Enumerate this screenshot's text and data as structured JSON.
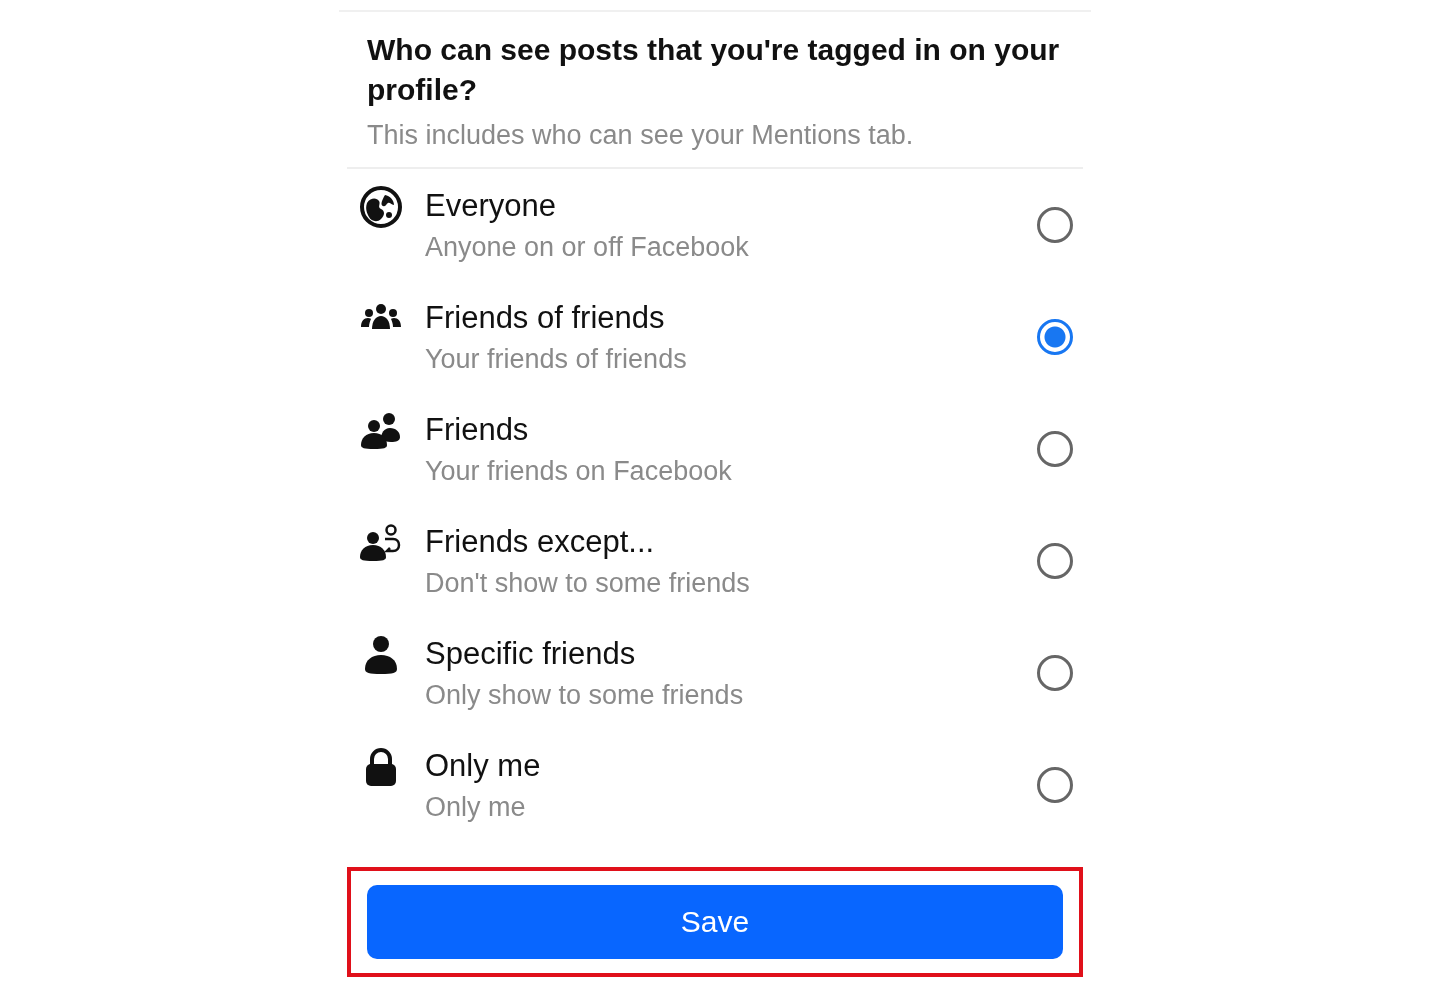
{
  "heading": "Who can see posts that you're tagged in on your profile?",
  "subheading": "This includes who can see your Mentions tab.",
  "options": [
    {
      "kind": "globe",
      "label": "Everyone",
      "description": "Anyone on or off Facebook",
      "selected": false
    },
    {
      "kind": "crowd",
      "label": "Friends of friends",
      "description": "Your friends of friends",
      "selected": true
    },
    {
      "kind": "pair",
      "label": "Friends",
      "description": "Your friends on Facebook",
      "selected": false
    },
    {
      "kind": "except",
      "label": "Friends except...",
      "description": "Don't show to some friends",
      "selected": false
    },
    {
      "kind": "person",
      "label": "Specific friends",
      "description": "Only show to some friends",
      "selected": false
    },
    {
      "kind": "lock",
      "label": "Only me",
      "description": "Only me",
      "selected": false
    }
  ],
  "save_button": {
    "label": "Save",
    "highlighted": true
  }
}
